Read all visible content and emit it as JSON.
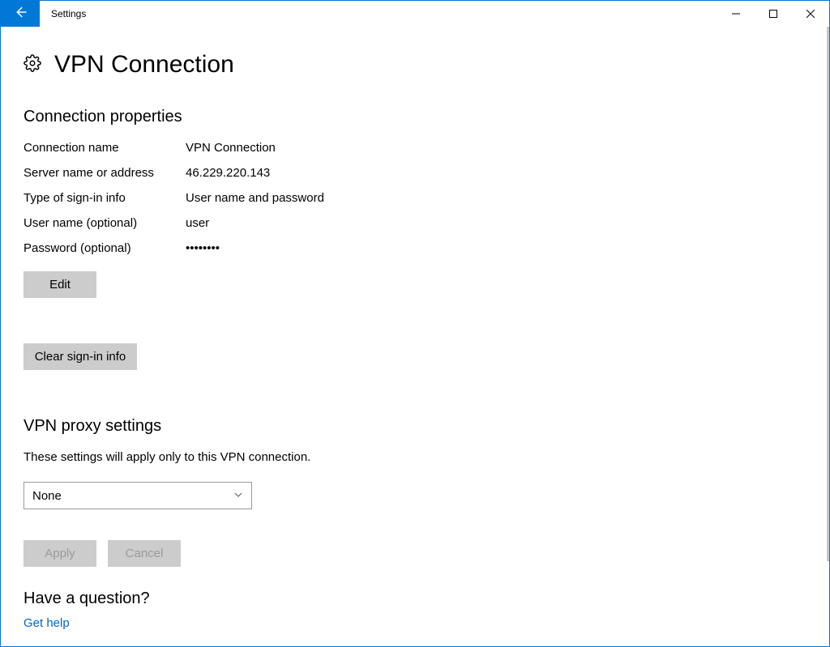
{
  "window": {
    "title": "Settings"
  },
  "page": {
    "title": "VPN Connection"
  },
  "sections": {
    "properties_heading": "Connection properties",
    "proxy_heading": "VPN proxy settings",
    "question_heading": "Have a question?"
  },
  "properties": {
    "labels": {
      "connection_name": "Connection name",
      "server": "Server name or address",
      "signin_type": "Type of sign-in info",
      "username": "User name (optional)",
      "password": "Password (optional)"
    },
    "values": {
      "connection_name": "VPN Connection",
      "server": "46.229.220.143",
      "signin_type": "User name and password",
      "username": "user",
      "password": "••••••••"
    }
  },
  "buttons": {
    "edit": "Edit",
    "clear_signin": "Clear sign-in info",
    "apply": "Apply",
    "cancel": "Cancel"
  },
  "proxy": {
    "description": "These settings will apply only to this VPN connection.",
    "selected": "None"
  },
  "help": {
    "link": "Get help"
  }
}
